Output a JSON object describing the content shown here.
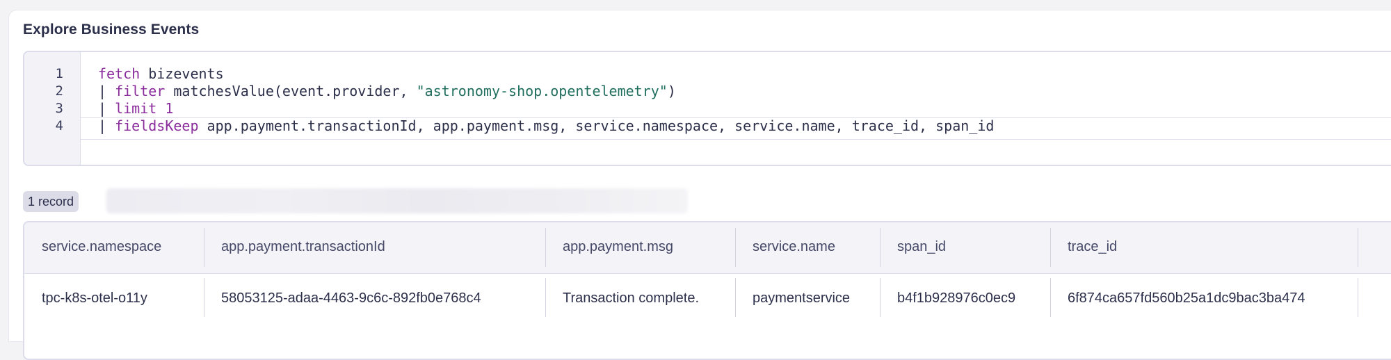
{
  "panel": {
    "title": "Explore Business Events"
  },
  "editor": {
    "line_numbers": [
      "1",
      "2",
      "3",
      "4"
    ],
    "lines": [
      {
        "k1": "fetch",
        "t1": " bizevents"
      },
      {
        "p": "| ",
        "k1": "filter",
        "t1": " matchesValue(event.provider, ",
        "s1": "\"astronomy-shop.opentelemetry\"",
        "t2": ")"
      },
      {
        "p": "| ",
        "k1": "limit",
        "t1": " ",
        "n1": "1"
      },
      {
        "p": "| ",
        "k1": "fieldsKeep",
        "t1": " app.payment.transactionId, app.payment.msg, service.namespace, service.name, trace_id, span_id"
      }
    ]
  },
  "results": {
    "record_count": "1 record"
  },
  "table": {
    "columns": [
      "service.namespace",
      "app.payment.transactionId",
      "app.payment.msg",
      "service.name",
      "span_id",
      "trace_id"
    ],
    "rows": [
      [
        "tpc-k8s-otel-o11y",
        "58053125-adaa-4463-9c6c-892fb0e768c4",
        "Transaction complete.",
        "paymentservice",
        "b4f1b928976c0ec9",
        "6f874ca657fd560b25a1dc9bac3ba474"
      ]
    ]
  }
}
